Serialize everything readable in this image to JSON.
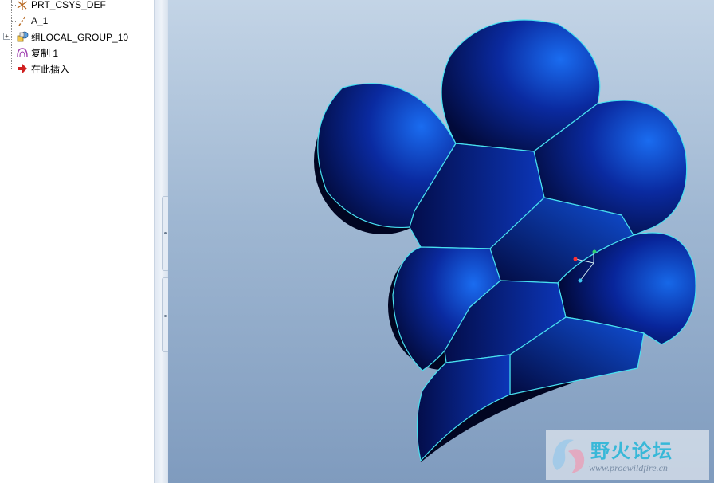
{
  "model_tree": {
    "items": [
      {
        "label": "PRT_CSYS_DEF",
        "icon": "csys-icon"
      },
      {
        "label": "A_1",
        "icon": "axis-icon"
      },
      {
        "label": "组LOCAL_GROUP_10",
        "icon": "group-icon",
        "expander": "+"
      },
      {
        "label": "复制 1",
        "icon": "copy-feature-icon"
      },
      {
        "label": "在此插入",
        "icon": "insert-here-arrow-icon"
      }
    ]
  },
  "watermark": {
    "title": "野火论坛",
    "url": "www.proewildfire.cn"
  },
  "colors": {
    "surface_dark": "#020a3a",
    "surface_light": "#1a6cf0",
    "edge": "#48e0f0",
    "viewport_top": "#c3d4e6",
    "viewport_bottom": "#7f9bbe"
  }
}
